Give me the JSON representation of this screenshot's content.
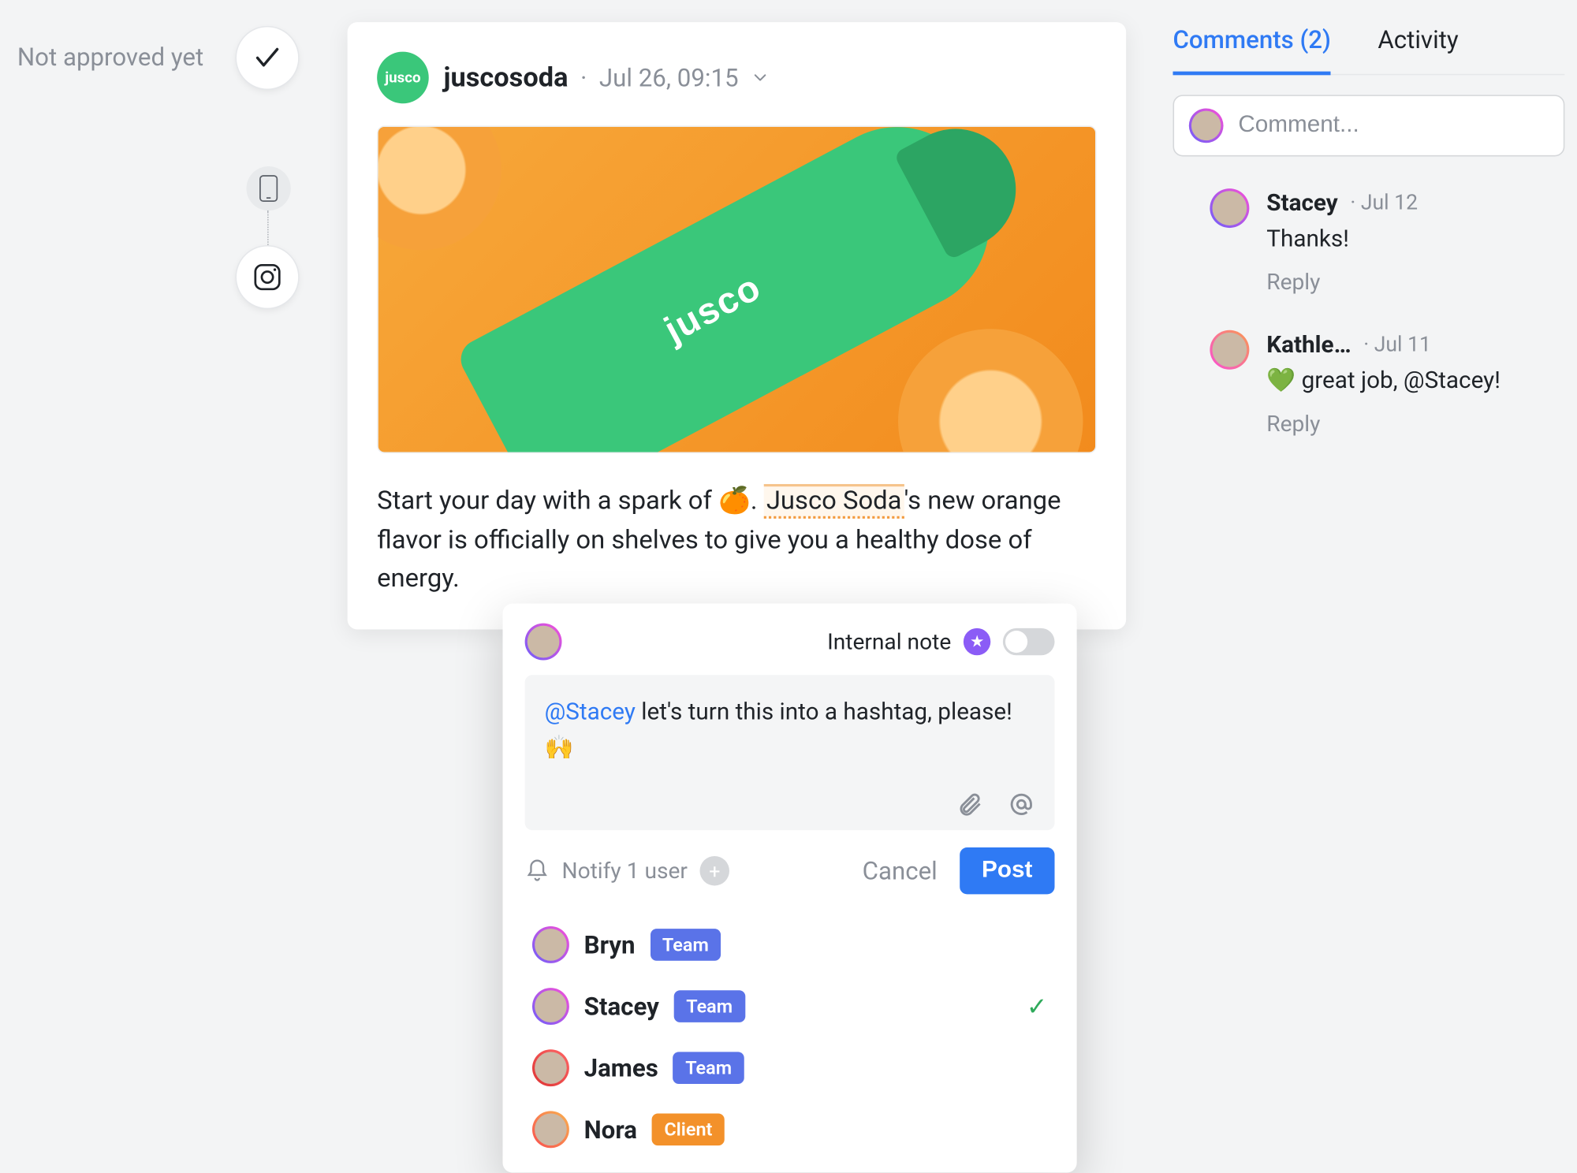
{
  "approval": {
    "label": "Not approved yet"
  },
  "post": {
    "brand_short": "jusco",
    "handle": "juscosoda",
    "timestamp": "Jul 26, 09:15",
    "caption_pre": "Start your day with a spark of 🍊. ",
    "caption_brand": "Jusco Soda",
    "caption_post": "'s new orange flavor is officially on shelves to give you a healthy dose of energy.",
    "image_label": "jusco"
  },
  "composer": {
    "note_label": "Internal note",
    "mention": "@Stacey",
    "text": " let's turn this into a hashtag, please! 🙌",
    "notify_text": "Notify 1 user",
    "cancel_label": "Cancel",
    "post_label": "Post",
    "users": [
      {
        "name": "Bryn",
        "role": "Team",
        "role_class": "role-team",
        "selected": false,
        "ring": ""
      },
      {
        "name": "Stacey",
        "role": "Team",
        "role_class": "role-team",
        "selected": true,
        "ring": ""
      },
      {
        "name": "James",
        "role": "Team",
        "role_class": "role-team",
        "selected": false,
        "ring": "ring-red"
      },
      {
        "name": "Nora",
        "role": "Client",
        "role_class": "role-client",
        "selected": false,
        "ring": "ring-orange"
      }
    ]
  },
  "sidebar": {
    "tab_comments": "Comments (2)",
    "tab_activity": "Activity",
    "input_placeholder": "Comment...",
    "comments": [
      {
        "name": "Stacey",
        "date": "Jul 12",
        "text": "Thanks!",
        "reply": "Reply",
        "ring": ""
      },
      {
        "name": "Kathle…",
        "date": "Jul 11",
        "text": "💚 great job, @Stacey!",
        "reply": "Reply",
        "ring": "ring-pink"
      }
    ]
  }
}
